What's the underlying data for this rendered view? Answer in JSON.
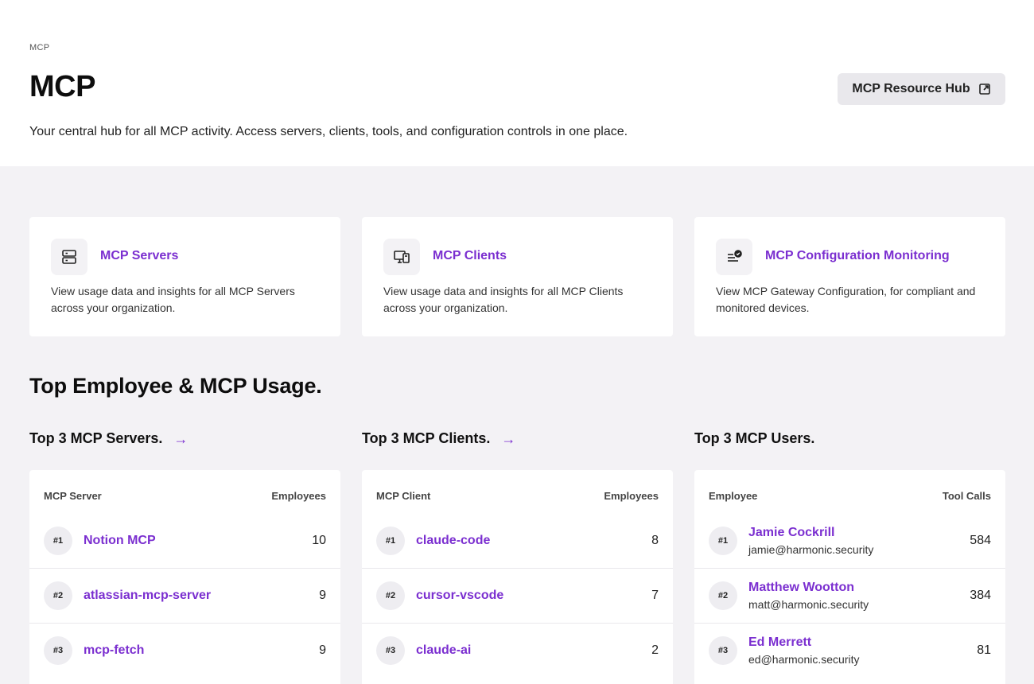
{
  "header": {
    "breadcrumb": "MCP",
    "title": "MCP",
    "subtitle": "Your central hub for all MCP activity. Access servers, clients, tools, and configuration controls in one place.",
    "resource_hub_label": "MCP Resource Hub"
  },
  "nav_cards": [
    {
      "title": "MCP Servers",
      "description": "View usage data and insights for all MCP Servers across your organization.",
      "icon": "server-icon"
    },
    {
      "title": "MCP Clients",
      "description": "View usage data and insights for all MCP Clients across your organization.",
      "icon": "devices-icon"
    },
    {
      "title": "MCP Configuration Monitoring",
      "description": "View MCP Gateway Configuration, for compliant and monitored devices.",
      "icon": "config-check-icon"
    }
  ],
  "section_title": "Top Employee & MCP Usage.",
  "top_servers": {
    "title": "Top 3 MCP Servers.",
    "col_left": "MCP Server",
    "col_right": "Employees",
    "rows": [
      {
        "rank": "#1",
        "name": "Notion MCP",
        "value": "10"
      },
      {
        "rank": "#2",
        "name": "atlassian-mcp-server",
        "value": "9"
      },
      {
        "rank": "#3",
        "name": "mcp-fetch",
        "value": "9"
      }
    ]
  },
  "top_clients": {
    "title": "Top 3 MCP Clients.",
    "col_left": "MCP Client",
    "col_right": "Employees",
    "rows": [
      {
        "rank": "#1",
        "name": "claude-code",
        "value": "8"
      },
      {
        "rank": "#2",
        "name": "cursor-vscode",
        "value": "7"
      },
      {
        "rank": "#3",
        "name": "claude-ai",
        "value": "2"
      }
    ]
  },
  "top_users": {
    "title": "Top 3 MCP Users.",
    "col_left": "Employee",
    "col_right": "Tool Calls",
    "rows": [
      {
        "rank": "#1",
        "name": "Jamie Cockrill",
        "email": "jamie@harmonic.security",
        "value": "584"
      },
      {
        "rank": "#2",
        "name": "Matthew Wootton",
        "email": "matt@harmonic.security",
        "value": "384"
      },
      {
        "rank": "#3",
        "name": "Ed Merrett",
        "email": "ed@harmonic.security",
        "value": "81"
      }
    ]
  },
  "colors": {
    "accent": "#7b2fd0",
    "background": "#f3f2f5",
    "card": "#ffffff"
  }
}
